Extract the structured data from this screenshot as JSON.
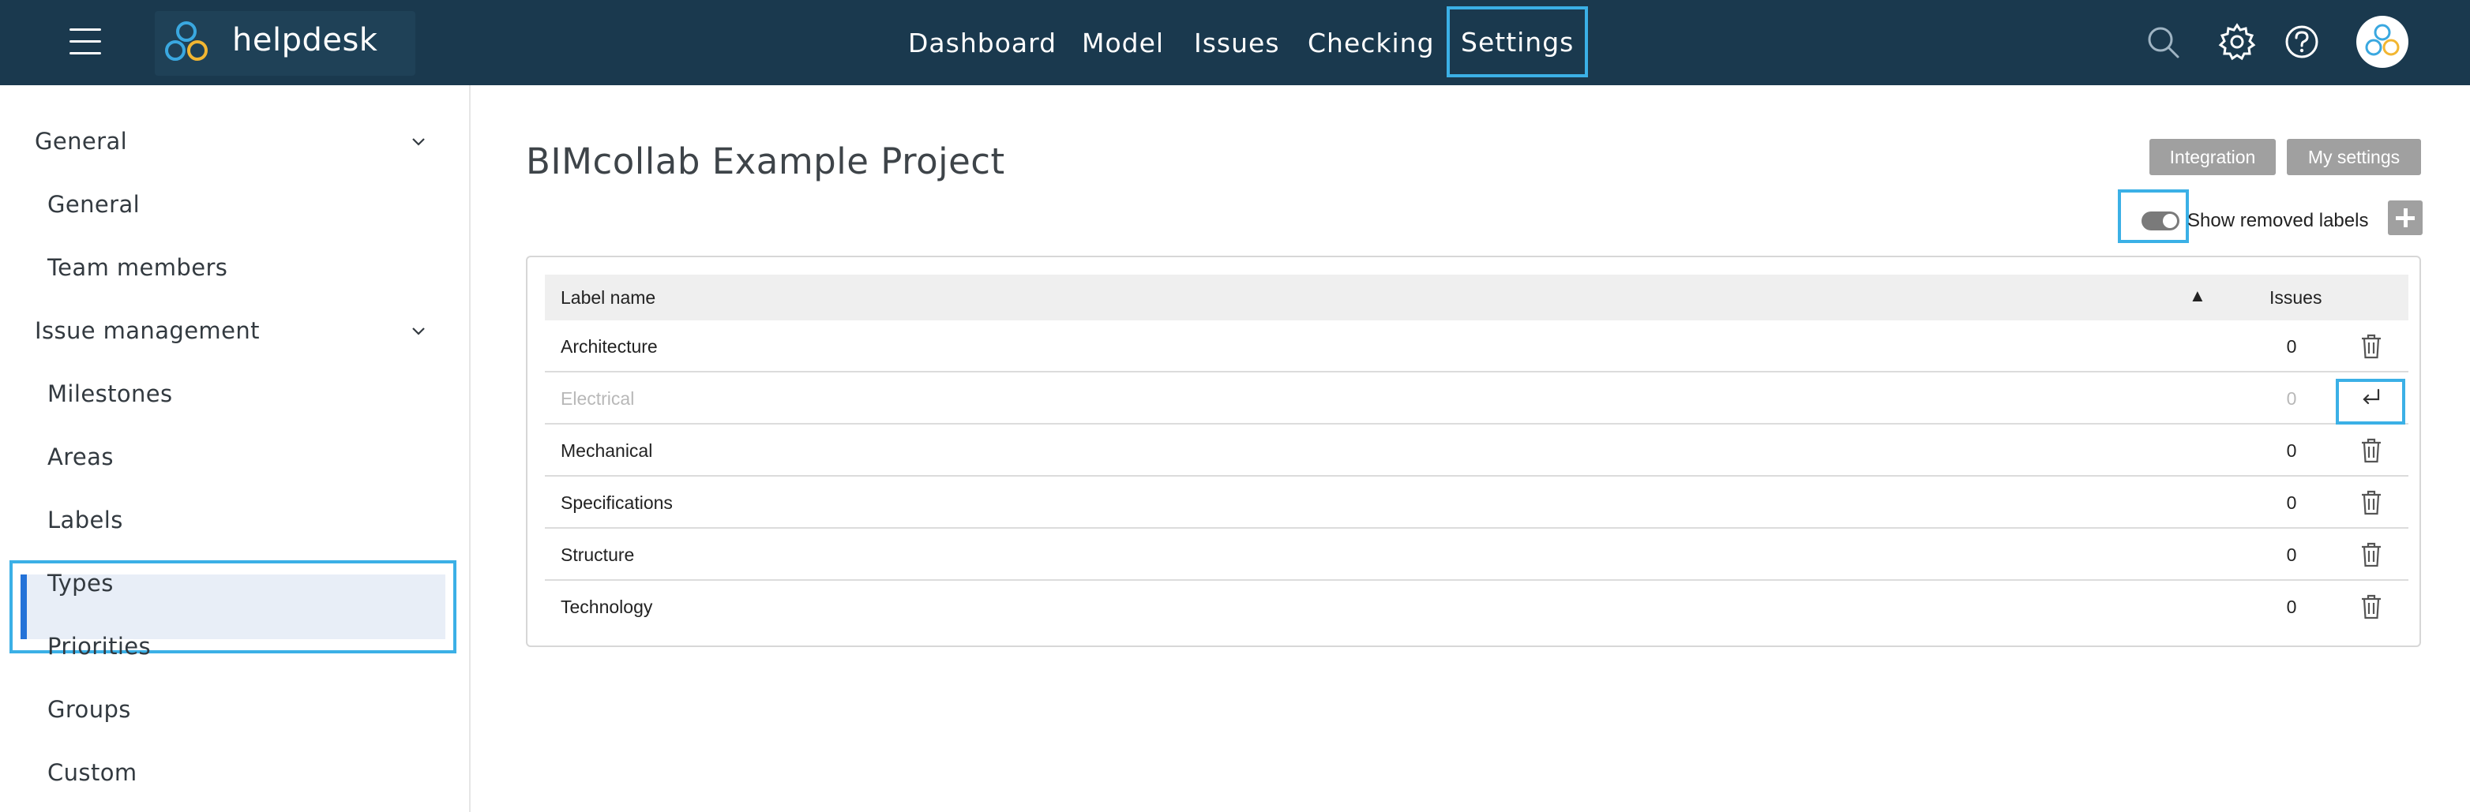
{
  "topbar": {
    "brand": "helpdesk",
    "nav": [
      {
        "label": "Dashboard"
      },
      {
        "label": "Model"
      },
      {
        "label": "Issues"
      },
      {
        "label": "Checking"
      },
      {
        "label": "Settings"
      }
    ],
    "icons": [
      "search-icon",
      "gear-icon",
      "help-icon",
      "avatar"
    ],
    "colors": {
      "background": "#1a394e",
      "highlight": "#3bb0e6"
    }
  },
  "sidebar": {
    "groups": [
      {
        "label": "General",
        "items": [
          {
            "label": "General"
          },
          {
            "label": "Team members"
          }
        ]
      },
      {
        "label": "Issue management",
        "items": [
          {
            "label": "Milestones"
          },
          {
            "label": "Areas"
          },
          {
            "label": "Labels"
          },
          {
            "label": "Types"
          },
          {
            "label": "Priorities"
          },
          {
            "label": "Groups"
          },
          {
            "label": "Custom"
          }
        ]
      }
    ],
    "active_item": "Labels",
    "colors": {
      "active_bg": "#e8eef7",
      "active_bar": "#2372d8"
    }
  },
  "main": {
    "title": "BIMcollab Example Project",
    "buttons": {
      "integration": "Integration",
      "my_settings": "My settings"
    },
    "toggle": {
      "label": "Show removed labels",
      "on": true
    },
    "table": {
      "columns": {
        "name": "Label name",
        "sort_indicator": "▲",
        "issues": "Issues"
      },
      "rows": [
        {
          "name": "Architecture",
          "issues": "0",
          "removed": false
        },
        {
          "name": "Electrical",
          "issues": "0",
          "removed": true
        },
        {
          "name": "Mechanical",
          "issues": "0",
          "removed": false
        },
        {
          "name": "Specifications",
          "issues": "0",
          "removed": false
        },
        {
          "name": "Structure",
          "issues": "0",
          "removed": false
        },
        {
          "name": "Technology",
          "issues": "0",
          "removed": false
        }
      ]
    }
  }
}
